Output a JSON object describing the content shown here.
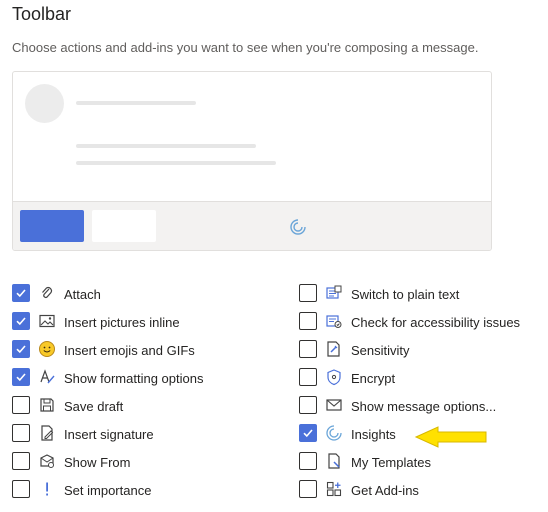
{
  "heading": "Toolbar",
  "description": "Choose actions and add-ins you want to see when you're composing a message.",
  "colors": {
    "accent": "#4a70d9",
    "arrow": "#ffe100"
  },
  "left_options": [
    {
      "label": "Attach",
      "checked": true,
      "icon": "paperclip-icon"
    },
    {
      "label": "Insert pictures inline",
      "checked": true,
      "icon": "picture-icon"
    },
    {
      "label": "Insert emojis and GIFs",
      "checked": true,
      "icon": "emoji-icon"
    },
    {
      "label": "Show formatting options",
      "checked": true,
      "icon": "format-icon"
    },
    {
      "label": "Save draft",
      "checked": false,
      "icon": "save-icon"
    },
    {
      "label": "Insert signature",
      "checked": false,
      "icon": "signature-icon"
    },
    {
      "label": "Show From",
      "checked": false,
      "icon": "show-from-icon"
    },
    {
      "label": "Set importance",
      "checked": false,
      "icon": "importance-icon"
    }
  ],
  "right_options": [
    {
      "label": "Switch to plain text",
      "checked": false,
      "icon": "plain-text-icon"
    },
    {
      "label": "Check for accessibility issues",
      "checked": false,
      "icon": "accessibility-icon"
    },
    {
      "label": "Sensitivity",
      "checked": false,
      "icon": "sensitivity-icon"
    },
    {
      "label": "Encrypt",
      "checked": false,
      "icon": "encrypt-icon"
    },
    {
      "label": "Show message options...",
      "checked": false,
      "icon": "message-options-icon"
    },
    {
      "label": "Insights",
      "checked": true,
      "icon": "insights-icon"
    },
    {
      "label": "My Templates",
      "checked": false,
      "icon": "templates-icon"
    },
    {
      "label": "Get Add-ins",
      "checked": false,
      "icon": "add-ins-icon"
    }
  ]
}
